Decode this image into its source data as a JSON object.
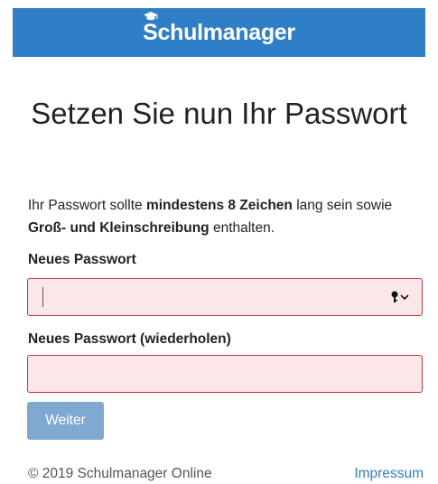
{
  "header": {
    "brand_first": "S",
    "brand_rest": "chulmanager",
    "background_color": "#2f7fc6"
  },
  "main": {
    "title": "Setzen Sie nun Ihr Passwort",
    "intro_1": "Ihr Passwort sollte ",
    "intro_bold_1": "mindestens 8 Zeichen",
    "intro_2": " lang sein sowie ",
    "intro_bold_2": "Groß- und Kleinschreibung",
    "intro_3": " enthalten.",
    "new_password_label": "Neues Passwort",
    "new_password_value": "",
    "repeat_password_label": "Neues Passwort (wiederholen)",
    "repeat_password_value": "",
    "submit_label": "Weiter"
  },
  "footer": {
    "copyright": "© 2019 Schulmanager Online",
    "imprint_link": "Impressum"
  },
  "icons": {
    "brand": "graduation-cap-icon",
    "password_manager": "key-icon",
    "dropdown": "chevron-down-icon"
  },
  "colors": {
    "accent": "#2f7fc6",
    "error_border": "#c0343e",
    "error_fill": "#fbe7e8",
    "button_disabled": "#7fa9d1"
  }
}
